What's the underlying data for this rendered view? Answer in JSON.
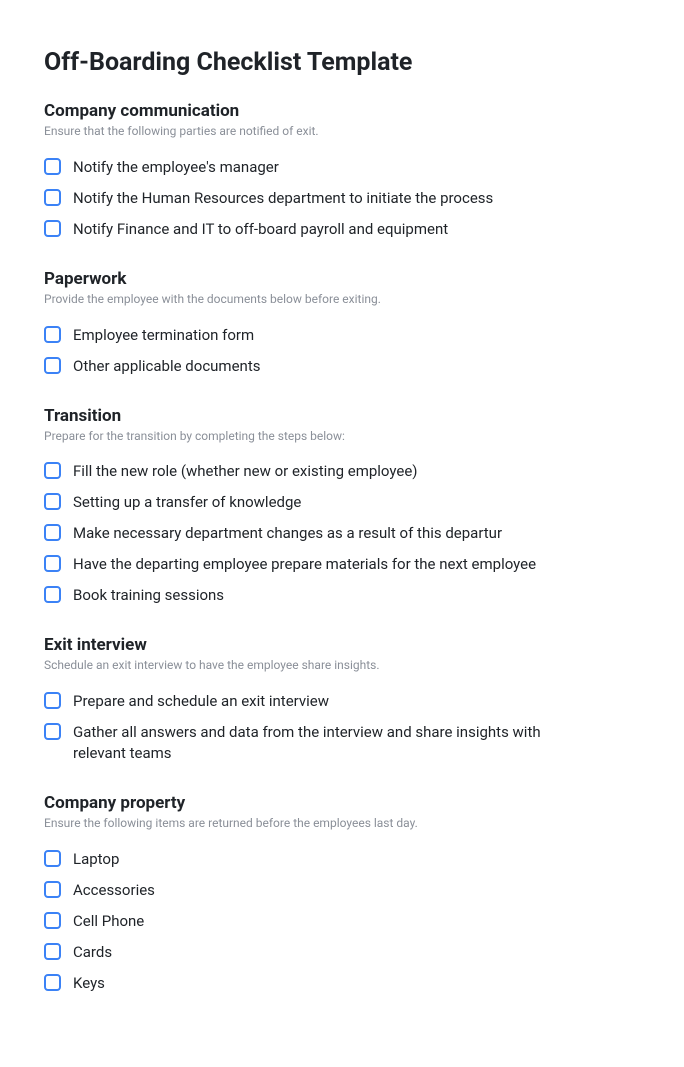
{
  "title": "Off-Boarding Checklist Template",
  "sections": [
    {
      "heading": "Company communication",
      "description": "Ensure that the following parties are notified of exit.",
      "items": [
        "Notify the employee's manager",
        "Notify the Human Resources department to initiate the process",
        "Notify Finance and IT to off-board payroll and equipment"
      ]
    },
    {
      "heading": "Paperwork",
      "description": "Provide the employee with the documents below before exiting.",
      "items": [
        "Employee termination form",
        "Other applicable documents"
      ]
    },
    {
      "heading": "Transition",
      "description": "Prepare for the transition by completing the steps below:",
      "items": [
        "Fill the new role (whether new or existing employee)",
        "Setting up a transfer of knowledge",
        "Make necessary department changes as a result of this departur",
        "Have the departing employee prepare materials for the next employee",
        "Book training sessions"
      ]
    },
    {
      "heading": "Exit interview",
      "description": "Schedule an exit interview to have the employee share insights.",
      "items": [
        "Prepare and schedule an exit interview",
        "Gather all answers and data from the interview and share insights with relevant teams"
      ]
    },
    {
      "heading": "Company property",
      "description": "Ensure the following items are returned before the employees last day.",
      "items": [
        "Laptop",
        "Accessories",
        "Cell Phone",
        "Cards",
        "Keys"
      ]
    }
  ]
}
